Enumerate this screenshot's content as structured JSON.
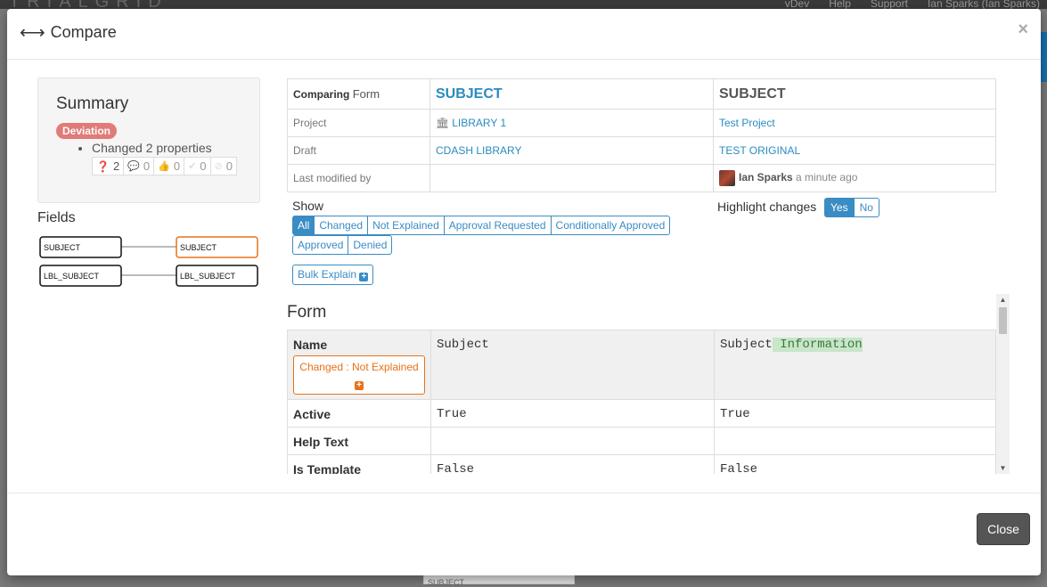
{
  "background": {
    "logo": "TRIALGRID",
    "nav": [
      "vDev",
      "Help",
      "Support",
      "Ian Sparks (Ian Sparks)"
    ],
    "bottom_text": "SUBJECT"
  },
  "modal": {
    "title": "Compare",
    "close_label": "Close"
  },
  "summary": {
    "title": "Summary",
    "badge": "Deviation",
    "change_text": "Changed 2 properties",
    "counts": [
      {
        "icon": "question-icon",
        "glyph": "?",
        "value": "2"
      },
      {
        "icon": "comment-icon",
        "glyph": "◯",
        "value": "0"
      },
      {
        "icon": "thumbs-up-icon",
        "glyph": "▲",
        "value": "0"
      },
      {
        "icon": "check-icon",
        "glyph": "✔",
        "value": "0"
      },
      {
        "icon": "ban-icon",
        "glyph": "⊘",
        "value": "0"
      }
    ]
  },
  "fields": {
    "title": "Fields",
    "rows": [
      {
        "left": "SUBJECT",
        "right": "SUBJECT",
        "right_changed": true
      },
      {
        "left": "LBL_SUBJECT",
        "right": "LBL_SUBJECT",
        "right_changed": false
      }
    ]
  },
  "compare": {
    "comparing_bold": "Comparing",
    "comparing_type": "Form",
    "left_form": "SUBJECT",
    "right_form": "SUBJECT",
    "rows": [
      {
        "label": "Project",
        "left": "LIBRARY 1",
        "right": "Test Project"
      },
      {
        "label": "Draft",
        "left": "CDASH LIBRARY",
        "right": "TEST ORIGINAL"
      }
    ],
    "last_modified_label": "Last modified by",
    "last_modified_user": "Ian Sparks",
    "last_modified_ago": "a minute ago"
  },
  "show": {
    "label": "Show",
    "filters_row1": [
      "All",
      "Changed",
      "Not Explained",
      "Approval Requested",
      "Conditionally Approved"
    ],
    "filters_row2": [
      "Approved",
      "Denied"
    ],
    "active": "All"
  },
  "highlight": {
    "label": "Highlight changes",
    "yes": "Yes",
    "no": "No",
    "active": "Yes"
  },
  "bulk_explain": "Bulk Explain",
  "form_section": {
    "title": "Form",
    "rows": [
      {
        "key": "Name",
        "left": "Subject",
        "right": "Subject",
        "right_added": " Information",
        "badge": "Changed : Not Explained"
      },
      {
        "key": "Active",
        "left": "True",
        "right": "True"
      },
      {
        "key": "Help Text",
        "left": "",
        "right": ""
      },
      {
        "key": "Is Template",
        "left": "False",
        "right": "False"
      }
    ]
  },
  "colors": {
    "primary": "#3a8cc4",
    "warning": "#e7721a",
    "danger": "#d9534f",
    "diff_add": "#c8e6c9"
  }
}
